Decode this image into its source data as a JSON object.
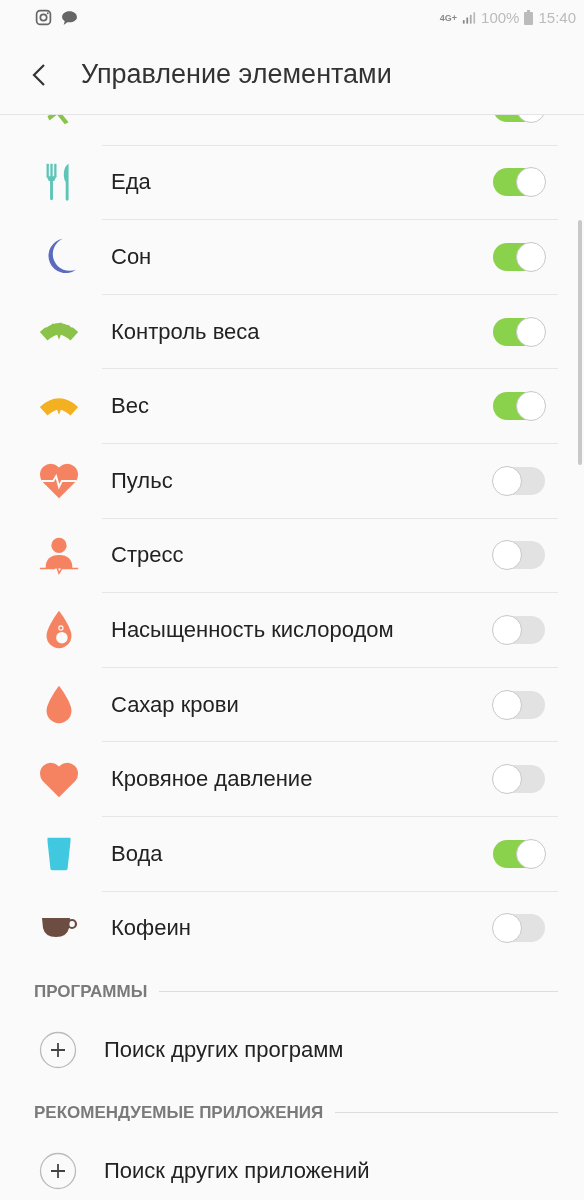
{
  "status_bar": {
    "network": "4G+",
    "battery": "100%",
    "time": "15:40"
  },
  "header": {
    "title": "Управление элементами"
  },
  "items": [
    {
      "on": true
    },
    {
      "label": "Еда",
      "on": true
    },
    {
      "label": "Сон",
      "on": true
    },
    {
      "label": "Контроль веса",
      "on": true
    },
    {
      "label": "Вес",
      "on": true
    },
    {
      "label": "Пульс",
      "on": false
    },
    {
      "label": "Стресс",
      "on": false
    },
    {
      "label": "Насыщенность кислородом",
      "on": false
    },
    {
      "label": "Сахар крови",
      "on": false
    },
    {
      "label": "Кровяное давление",
      "on": false
    },
    {
      "label": "Вода",
      "on": true
    },
    {
      "label": "Кофеин",
      "on": false
    }
  ],
  "sections": [
    {
      "title": "ПРОГРАММЫ",
      "action": "Поиск других программ"
    },
    {
      "title": "РЕКОМЕНДУЕМЫЕ ПРИЛОЖЕНИЯ",
      "action": "Поиск других приложений"
    }
  ]
}
